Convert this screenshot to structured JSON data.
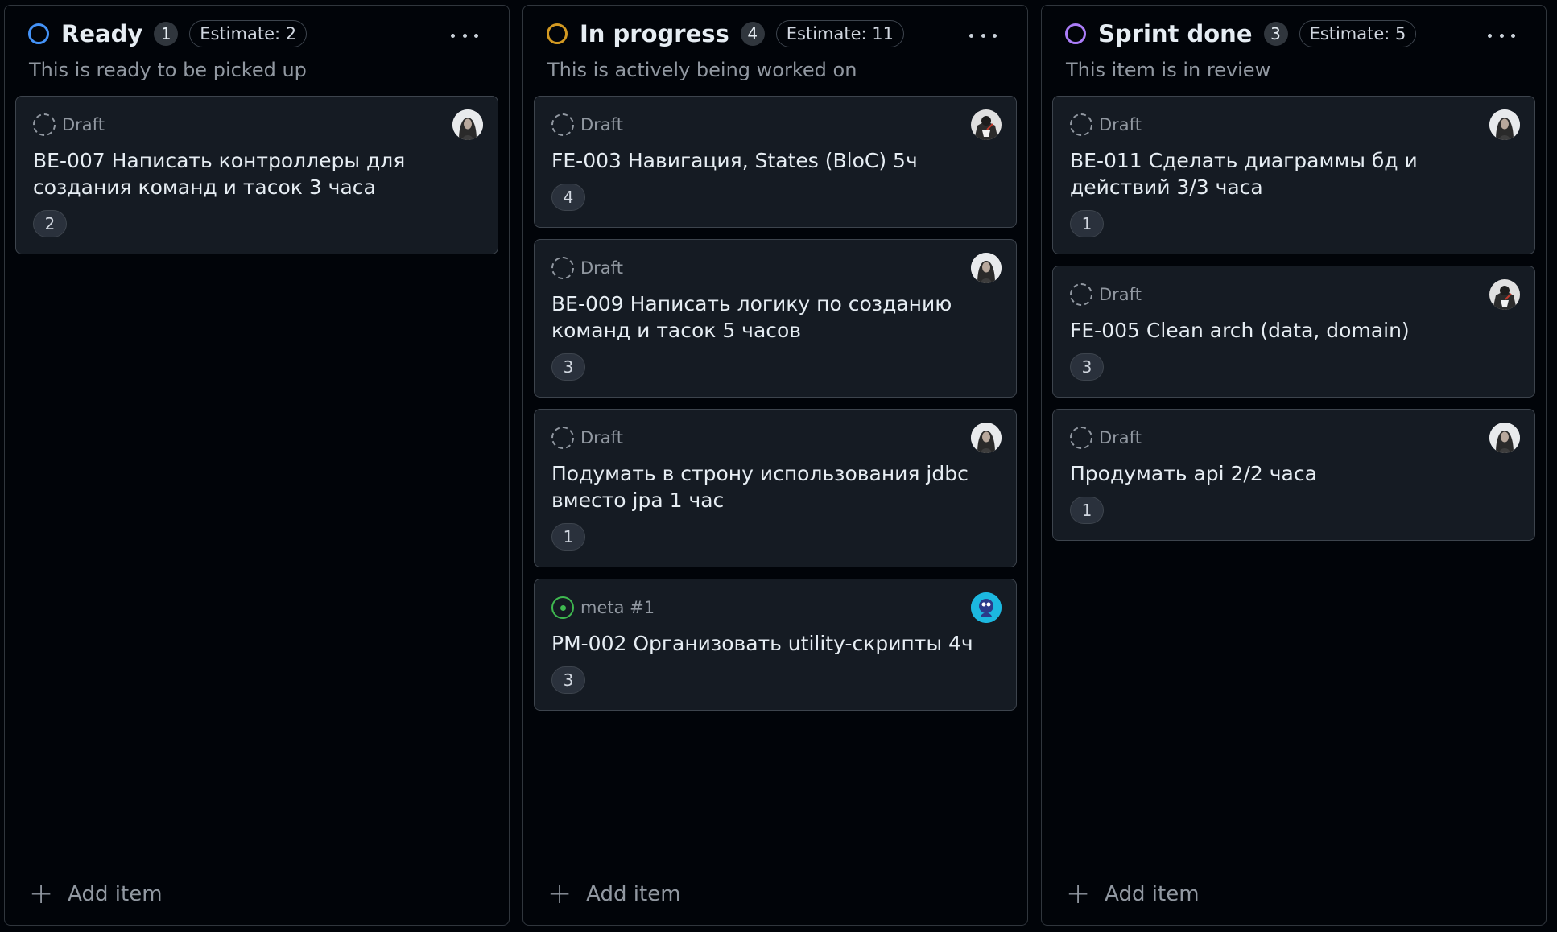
{
  "columns": [
    {
      "title": "Ready",
      "count": "1",
      "estimate": "Estimate: 2",
      "description": "This is ready to be picked up",
      "color": "#4493f8",
      "add_item": "Add item",
      "cards": [
        {
          "type": "Draft",
          "title": "BE-007 Написать контроллеры для создания команд и тасок 3 часа",
          "points": "2",
          "avatar": "woman-avatar"
        }
      ]
    },
    {
      "title": "In progress",
      "count": "4",
      "estimate": "Estimate: 11",
      "description": "This is actively being worked on",
      "color": "#d29922",
      "add_item": "Add item",
      "cards": [
        {
          "type": "Draft",
          "title": "FE-003 Навигация, States (BloC) 5ч",
          "points": "4",
          "avatar": "dark-avatar"
        },
        {
          "type": "Draft",
          "title": "BE-009 Написать логику по созданию команд и тасок 5 часов",
          "points": "3",
          "avatar": "woman-avatar"
        },
        {
          "type": "Draft",
          "title": "Подумать в строну использования jdbc вместо jpa 1 час",
          "points": "1",
          "avatar": "woman-avatar"
        },
        {
          "type": "meta #1",
          "title": "PM-002 Организовать utility-скрипты 4ч",
          "points": "3",
          "avatar": "cyan-avatar"
        }
      ]
    },
    {
      "title": "Sprint done",
      "count": "3",
      "estimate": "Estimate: 5",
      "description": "This item is in review",
      "color": "#ab7df8",
      "add_item": "Add item",
      "cards": [
        {
          "type": "Draft",
          "title": "BE-011 Сделать диаграммы бд и действий 3/3 часа",
          "points": "1",
          "avatar": "woman-avatar"
        },
        {
          "type": "Draft",
          "title": "FE-005 Clean arch (data, domain)",
          "points": "3",
          "avatar": "dark-avatar"
        },
        {
          "type": "Draft",
          "title": "Продумать api 2/2 часа",
          "points": "1",
          "avatar": "woman-avatar"
        }
      ]
    }
  ]
}
